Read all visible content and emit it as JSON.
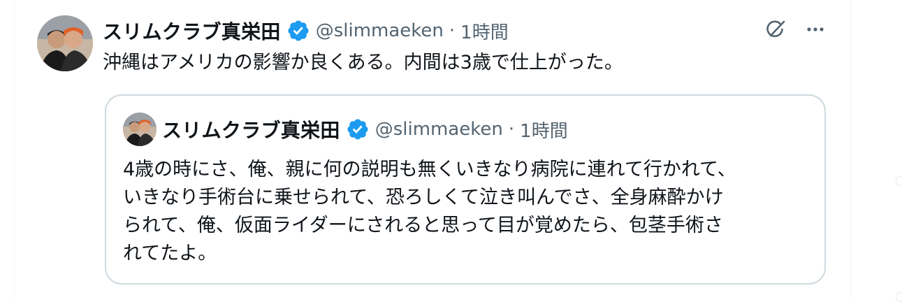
{
  "tweet": {
    "display_name": "スリムクラブ真栄田",
    "handle": "@slimmaeken",
    "separator": "·",
    "time": "1時間",
    "text": "沖縄はアメリカの影響か良くある。内間は3歳で仕上がった。",
    "verified": true,
    "accent_color": "#1d9bf0"
  },
  "quoted_tweet": {
    "display_name": "スリムクラブ真栄田",
    "handle": "@slimmaeken",
    "separator": "·",
    "time": "1時間",
    "verified": true,
    "text_lines": [
      "4歳の時にさ、俺、親に何の説明も無くいきなり病院に連れて行かれて、",
      "いきなり手術台に乗せられて、恐ろしくて泣き叫んでさ、全身麻酔かけ",
      "られて、俺、仮面ライダーにされると思って目が覚めたら、包茎手術さ",
      "れてたよ。"
    ]
  },
  "actions": {
    "grok_icon": "grok-icon",
    "more_icon": "more-icon"
  }
}
